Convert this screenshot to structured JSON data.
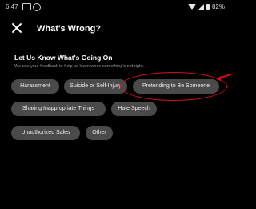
{
  "status_bar": {
    "time": "6:47",
    "battery": "82%"
  },
  "header": {
    "title": "What's Wrong?"
  },
  "section": {
    "title": "Let Us Know What's Going On",
    "subtitle": "We use your feedback to help us learn when something's not right."
  },
  "options": [
    {
      "label": "Harassment"
    },
    {
      "label": "Suicide or Self-Injury"
    },
    {
      "label": "Pretending to Be Someone"
    },
    {
      "label": "Sharing Inappropriate Things"
    },
    {
      "label": "Hate Speech"
    },
    {
      "label": "Unauthorized Sales"
    },
    {
      "label": "Other"
    }
  ],
  "annotation": {
    "color": "#d40f14",
    "icon": "red-ellipse-highlight-with-arrow"
  },
  "colors": {
    "background": "#000000",
    "chip": "#4a4a4a",
    "text": "#ffffff",
    "subtitle": "#9a9a9a"
  }
}
